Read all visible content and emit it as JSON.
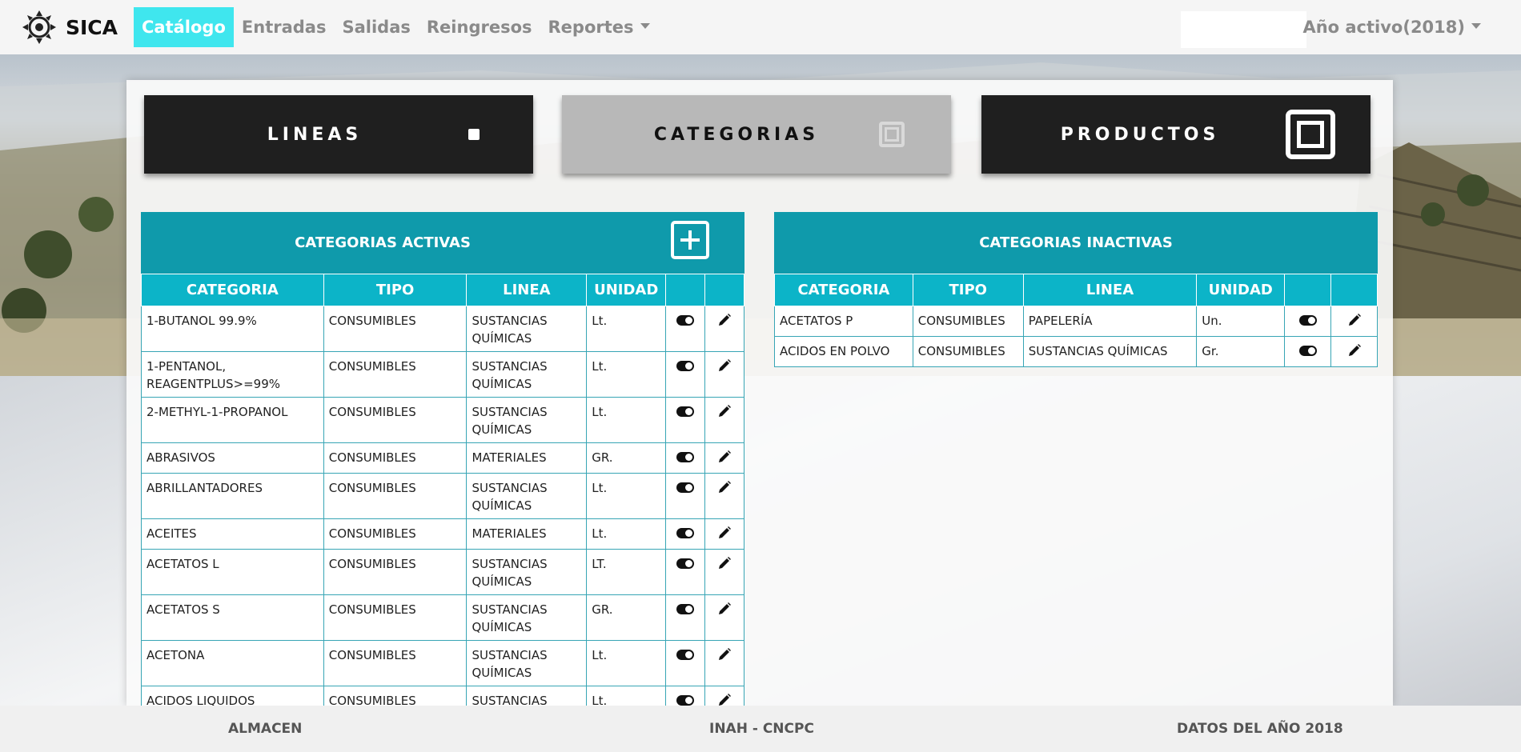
{
  "navbar": {
    "brand": "SICA",
    "items": [
      {
        "label": "Catálogo",
        "active": true
      },
      {
        "label": "Entradas",
        "active": false
      },
      {
        "label": "Salidas",
        "active": false
      },
      {
        "label": "Reingresos",
        "active": false
      },
      {
        "label": "Reportes",
        "active": false,
        "dropdown": true
      }
    ],
    "year_menu": "Año activo(2018)"
  },
  "big_buttons": [
    {
      "label": "LINEAS",
      "icon": "square-small-icon"
    },
    {
      "label": "CATEGORIAS",
      "icon": "square-outline-icon"
    },
    {
      "label": "PRODUCTOS",
      "icon": "square-outline-big-icon"
    }
  ],
  "active": {
    "title": "CATEGORIAS ACTIVAS",
    "headers": [
      "CATEGORIA",
      "TIPO",
      "LINEA",
      "UNIDAD",
      "",
      ""
    ],
    "rows": [
      {
        "cat": "1-BUTANOL 99.9%",
        "tipo": "CONSUMIBLES",
        "linea": "SUSTANCIAS QUÍMICAS",
        "unidad": "Lt."
      },
      {
        "cat": "1-PENTANOL, REAGENTPLUS>=99%",
        "tipo": "CONSUMIBLES",
        "linea": "SUSTANCIAS QUÍMICAS",
        "unidad": "Lt."
      },
      {
        "cat": "2-METHYL-1-PROPANOL",
        "tipo": "CONSUMIBLES",
        "linea": "SUSTANCIAS QUÍMICAS",
        "unidad": "Lt."
      },
      {
        "cat": "ABRASIVOS",
        "tipo": "CONSUMIBLES",
        "linea": "MATERIALES",
        "unidad": "GR."
      },
      {
        "cat": "ABRILLANTADORES",
        "tipo": "CONSUMIBLES",
        "linea": "SUSTANCIAS QUÍMICAS",
        "unidad": "Lt."
      },
      {
        "cat": "ACEITES",
        "tipo": "CONSUMIBLES",
        "linea": "MATERIALES",
        "unidad": "Lt."
      },
      {
        "cat": "ACETATOS L",
        "tipo": "CONSUMIBLES",
        "linea": "SUSTANCIAS QUÍMICAS",
        "unidad": "LT."
      },
      {
        "cat": "ACETATOS S",
        "tipo": "CONSUMIBLES",
        "linea": "SUSTANCIAS QUÍMICAS",
        "unidad": "GR."
      },
      {
        "cat": "ACETONA",
        "tipo": "CONSUMIBLES",
        "linea": "SUSTANCIAS QUÍMICAS",
        "unidad": "Lt."
      },
      {
        "cat": "ACIDOS LIQUIDOS",
        "tipo": "CONSUMIBLES",
        "linea": "SUSTANCIAS QUÍMICAS",
        "unidad": "Lt."
      }
    ]
  },
  "inactive": {
    "title": "CATEGORIAS INACTIVAS",
    "headers": [
      "CATEGORIA",
      "TIPO",
      "LINEA",
      "UNIDAD",
      "",
      ""
    ],
    "rows": [
      {
        "cat": "ACETATOS P",
        "tipo": "CONSUMIBLES",
        "linea": "PAPELERÍA",
        "unidad": "Un."
      },
      {
        "cat": "ACIDOS EN POLVO",
        "tipo": "CONSUMIBLES",
        "linea": "SUSTANCIAS QUÍMICAS",
        "unidad": "Gr."
      }
    ]
  },
  "footer": {
    "left": "ALMACEN",
    "center": "INAH - CNCPC",
    "right": "DATOS DEL AÑO 2018"
  },
  "colors": {
    "header_teal": "#0f9aab",
    "table_header": "#0cb4c8",
    "active_nav": "#3fe6ee"
  }
}
